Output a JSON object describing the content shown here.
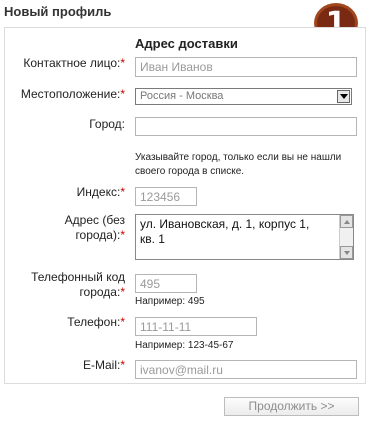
{
  "header": {
    "title": "Новый профиль",
    "step_number": "1"
  },
  "form": {
    "section_title": "Адрес доставки",
    "required_mark": "*",
    "contact": {
      "label": "Контактное лицо:",
      "value": "Иван Иванов"
    },
    "location": {
      "label": "Местоположение:",
      "selected": "Россия - Москва"
    },
    "city": {
      "label": "Город:",
      "value": "",
      "hint_line1": "Указывайте город, только если вы не нашли",
      "hint_line2": "своего города в списке."
    },
    "zip": {
      "label": "Индекс:",
      "value": "123456"
    },
    "address": {
      "label_line1": "Адрес (без",
      "label_line2": "города):",
      "value_line1": "ул. Ивановская, д. 1, корпус 1,",
      "value_line2": "кв. 1"
    },
    "phone_code": {
      "label_line1": "Телефонный код",
      "label_line2": "города:",
      "value": "495",
      "example": "Например: 495"
    },
    "phone": {
      "label": "Телефон:",
      "value": "111-11-11",
      "example": "Например: 123-45-67"
    },
    "email": {
      "label": "E-Mail:",
      "value": "ivanov@mail.ru"
    }
  },
  "footer": {
    "continue_label": "Продолжить >>"
  },
  "colors": {
    "badge": "#7a2a12",
    "required": "#cc0000"
  }
}
